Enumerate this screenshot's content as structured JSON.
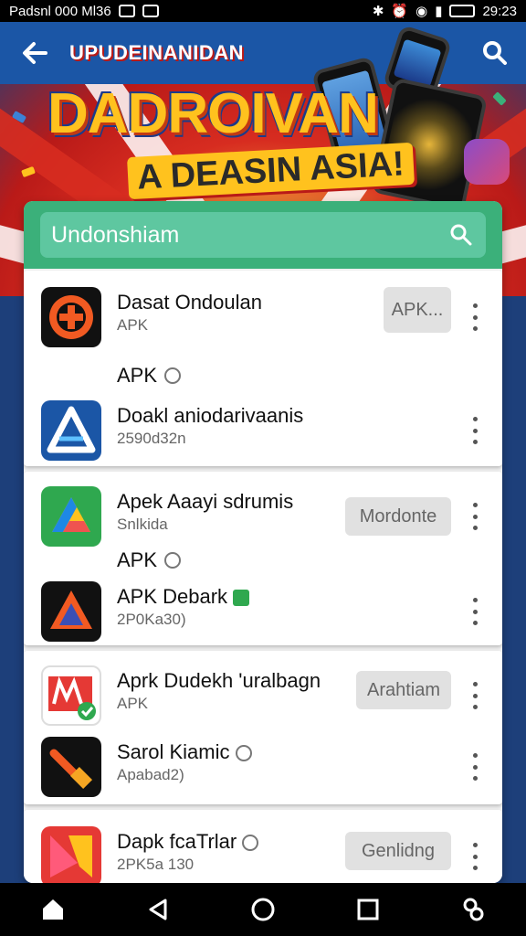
{
  "status_bar": {
    "left_text": "Pаdsnl 000 Ml36",
    "time": "29:23"
  },
  "header": {
    "title": "UPUDEINANIDAN",
    "back_icon": "arrow-left-icon",
    "search_icon": "search-icon"
  },
  "banner": {
    "headline": "DADROIVAN",
    "subline": "A DEASIN ASIA!"
  },
  "search": {
    "placeholder": "Undonshiam"
  },
  "sections": [
    {
      "rows": [
        {
          "name": "Dasat Ondoulan",
          "sub": "APK",
          "button": "APK...",
          "icon": "orange-black-logo-icon"
        },
        {
          "name": "Doakl aniodarivaanis",
          "sub": "2590d32n",
          "button": "",
          "icon": "blue-triangle-logo-icon"
        }
      ],
      "label": "APK"
    },
    {
      "rows": [
        {
          "name": "Apek Aaayi sdrumis",
          "sub": "Snlkida",
          "button": "Mordonte",
          "icon": "drive-triangle-icon"
        },
        {
          "name": "APK Debark",
          "sub": "2P0Kа30)",
          "button": "",
          "icon": "red-triangle-logo-icon"
        }
      ],
      "label": "APK"
    },
    {
      "rows": [
        {
          "name": "Aprk Dudekh 'uralbagn",
          "sub": "APK",
          "button": "Arahtiam",
          "icon": "red-check-logo-icon"
        },
        {
          "name": "Sarol Kiamic",
          "sub": "Apabad2)",
          "button": "",
          "icon": "orange-hammer-icon"
        }
      ]
    },
    {
      "rows": [
        {
          "name": "Dapk fcaTrlar",
          "sub": "2PK5a 130",
          "button": "Genlidng",
          "icon": "red-yellow-bookmark-icon"
        }
      ]
    }
  ],
  "nav": {
    "home": "home-icon",
    "back": "back-triangle-icon",
    "recent": "circle-home-icon",
    "square": "recents-square-icon",
    "assistant": "assistant-icon"
  },
  "colors": {
    "header_blue": "#1b56a6",
    "banner_red": "#d72c20",
    "search_green": "#3bb07a",
    "accent_yellow": "#ffc21e"
  }
}
